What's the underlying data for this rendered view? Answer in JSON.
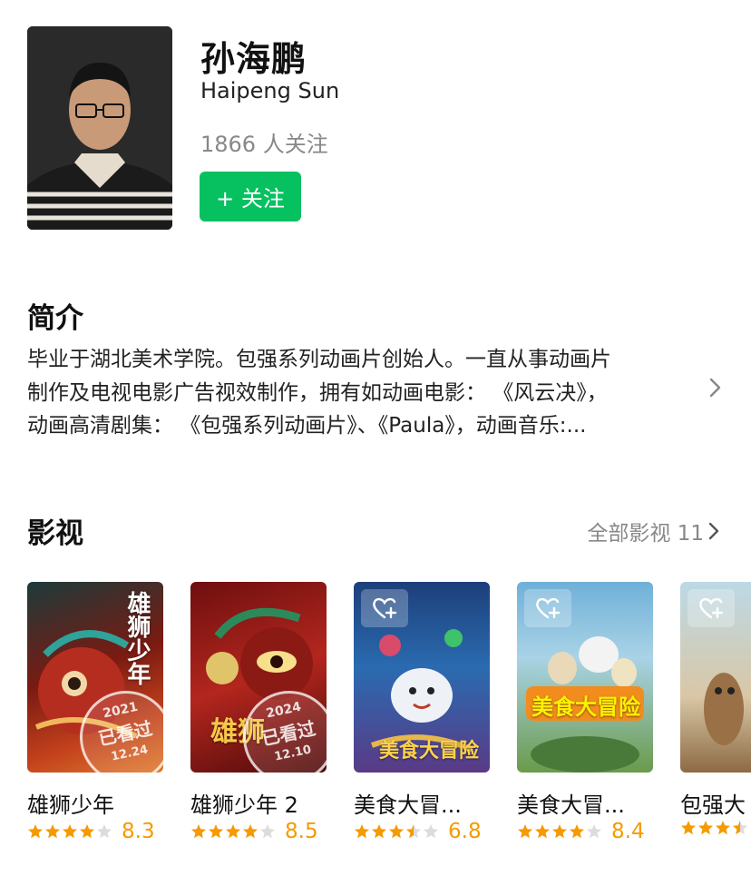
{
  "person": {
    "name": "孙海鹏",
    "name_en": "Haipeng Sun",
    "followers": "1866 人关注",
    "follow_label": "+ 关注"
  },
  "intro": {
    "heading": "简介",
    "lines": [
      "毕业于湖北美术学院。包强系列动画片创始人。一直从事动画片",
      "制作及电视电影广告视效制作，拥有如动画电影： 《风云决》，",
      "动画高清剧集： 《包强系列动画片》、《Paula》，动画音乐:..."
    ]
  },
  "films": {
    "heading": "影视",
    "see_all_label": "全部影视 11",
    "items": [
      {
        "title": "雄狮少年",
        "rating": 8.3,
        "stars": 4.0,
        "score": "8.3",
        "watched": true,
        "stamp_year": "2021",
        "stamp_text": "已看过",
        "stamp_date": "12.24",
        "poster_text": "雄狮少年"
      },
      {
        "title": "雄狮少年 2",
        "rating": 8.5,
        "stars": 4.0,
        "score": "8.5",
        "watched": true,
        "stamp_year": "2024",
        "stamp_text": "已看过",
        "stamp_date": "12.10",
        "poster_text": "雄狮"
      },
      {
        "title": "美食大冒...",
        "rating": 6.8,
        "stars": 3.5,
        "score": "6.8",
        "watched": false,
        "poster_text": "美食大冒险"
      },
      {
        "title": "美食大冒...",
        "rating": 8.4,
        "stars": 4.0,
        "score": "8.4",
        "watched": false,
        "poster_text": "美食大冒险"
      },
      {
        "title": "包强大",
        "rating": null,
        "stars": 3.5,
        "score": "",
        "watched": false,
        "poster_text": ""
      }
    ]
  },
  "colors": {
    "follow_green": "#07c160",
    "star_orange": "#f59a00",
    "star_empty": "#dcdcdc"
  },
  "icons": {
    "intro_more": "chevron-right-icon",
    "see_all": "chevron-right-icon",
    "want_to_watch": "heart-plus-icon",
    "rating": "star-icon"
  }
}
